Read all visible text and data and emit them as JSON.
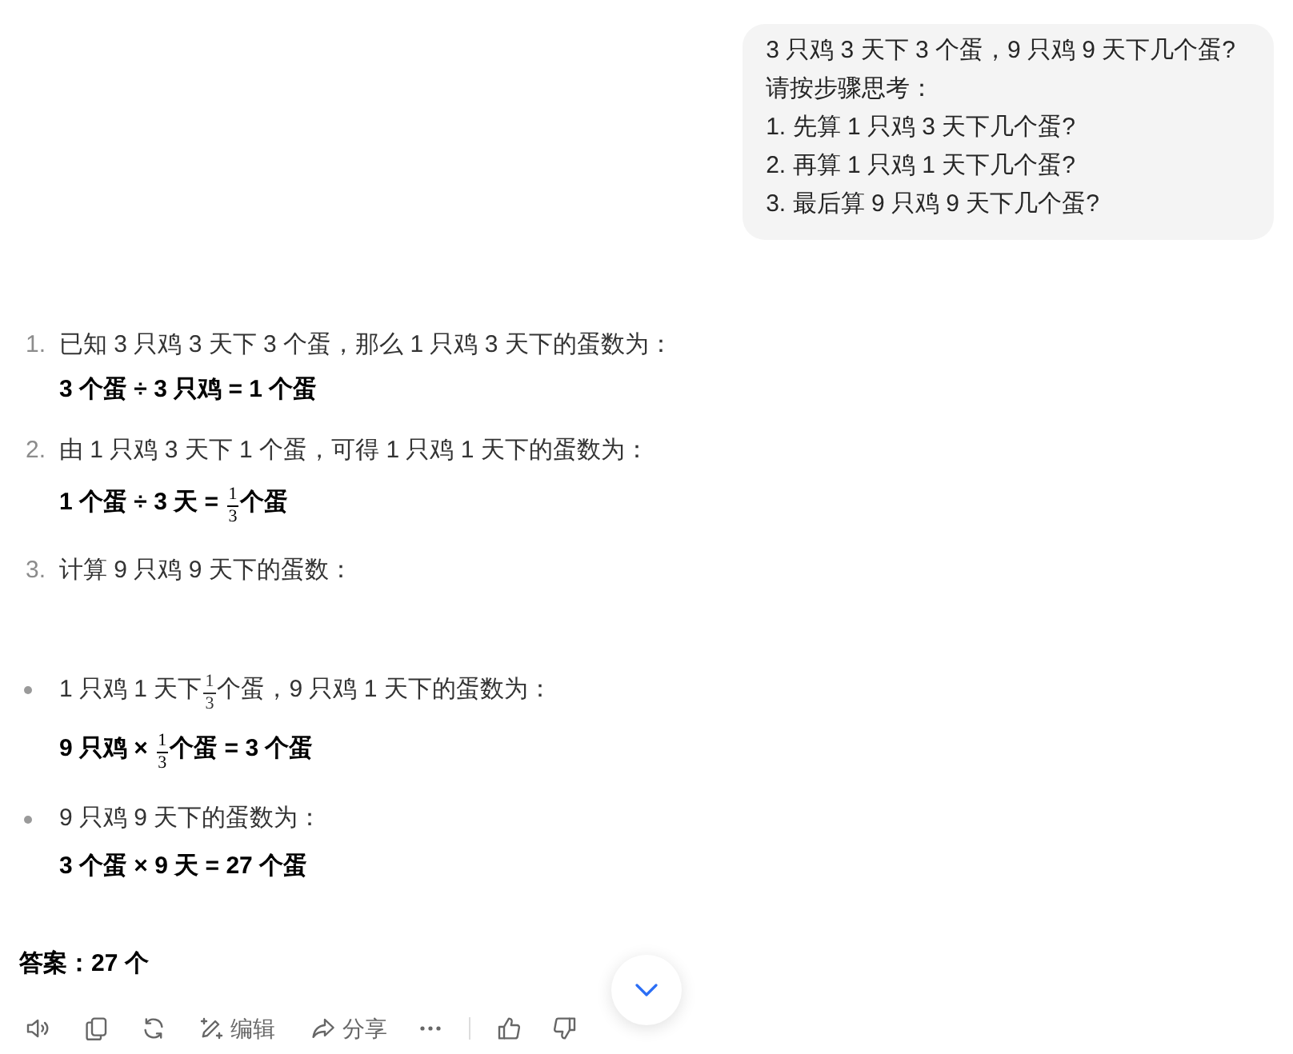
{
  "user_message": {
    "lines": [
      "3 只鸡 3 天下 3 个蛋，9 只鸡 9 天下几个蛋?",
      "请按步骤思考：",
      "1. 先算 1 只鸡 3 天下几个蛋?",
      "2. 再算 1 只鸡 1 天下几个蛋?",
      "3. 最后算 9 只鸡 9 天下几个蛋?"
    ]
  },
  "steps": [
    {
      "number": "1.",
      "text": [
        {
          "kind": "text",
          "text": "已知 3 只鸡 3 天下 3 个蛋，那么 1 只鸡 3 天下的蛋数为："
        }
      ],
      "formula": [
        {
          "kind": "text",
          "text": "3 个蛋 ÷ 3 只鸡 = 1 个蛋"
        }
      ]
    },
    {
      "number": "2.",
      "text": [
        {
          "kind": "text",
          "text": "由 1 只鸡 3 天下 1 个蛋，可得 1 只鸡 1 天下的蛋数为："
        }
      ],
      "formula": [
        {
          "kind": "text",
          "text": "1 个蛋 ÷ 3 天 = "
        },
        {
          "kind": "fraction",
          "numerator": "1",
          "denominator": "3"
        },
        {
          "kind": "text",
          "text": "个蛋"
        }
      ]
    },
    {
      "number": "3.",
      "text": [
        {
          "kind": "text",
          "text": "计算 9 只鸡 9 天下的蛋数："
        }
      ]
    }
  ],
  "bullets": [
    {
      "text": [
        {
          "kind": "text",
          "text": "1 只鸡 1 天下"
        },
        {
          "kind": "fraction",
          "numerator": "1",
          "denominator": "3"
        },
        {
          "kind": "text",
          "text": "个蛋，9 只鸡 1 天下的蛋数为："
        }
      ],
      "formula": [
        {
          "kind": "text",
          "text": "9 只鸡 × "
        },
        {
          "kind": "fraction",
          "numerator": "1",
          "denominator": "3"
        },
        {
          "kind": "text",
          "text": "个蛋 = 3 个蛋"
        }
      ]
    },
    {
      "text": [
        {
          "kind": "text",
          "text": "9 只鸡 9 天下的蛋数为："
        }
      ],
      "formula": [
        {
          "kind": "text",
          "text": "3 个蛋 × 9 天 = 27 个蛋"
        }
      ]
    }
  ],
  "answer": "答案：27 个",
  "actions": {
    "edit": "编辑",
    "share": "分享"
  }
}
